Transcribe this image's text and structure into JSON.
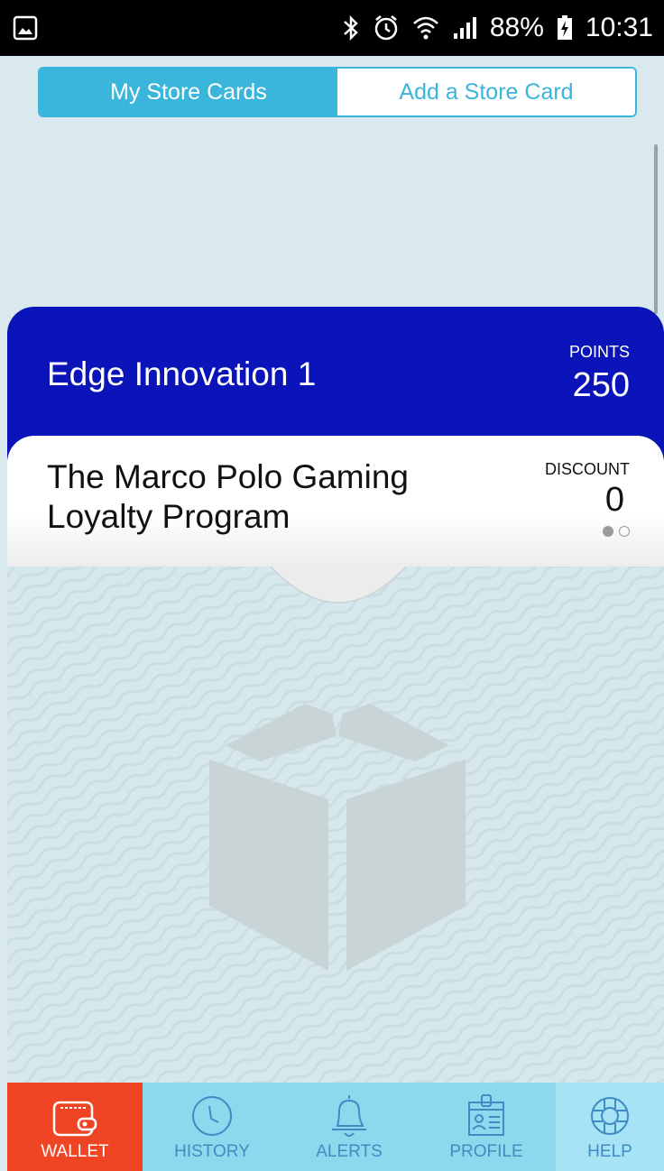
{
  "status_bar": {
    "battery": "88%",
    "time": "10:31"
  },
  "tabs": [
    {
      "label": "My Store Cards",
      "active": true
    },
    {
      "label": "Add a Store Card",
      "active": false
    }
  ],
  "cards": [
    {
      "name": "Edge Innovation 1",
      "metric_label": "POINTS",
      "metric_value": "250",
      "color": "#0a14b8"
    },
    {
      "name": "The Marco Polo Gaming Loyalty Program",
      "metric_label": "DISCOUNT",
      "metric_value": "0",
      "color": "#ffffff"
    }
  ],
  "pager": {
    "current": 1,
    "total": 2
  },
  "bottom_nav": [
    {
      "label": "WALLET",
      "icon": "wallet-icon",
      "active": true
    },
    {
      "label": "HISTORY",
      "icon": "clock-icon",
      "active": false
    },
    {
      "label": "ALERTS",
      "icon": "bell-icon",
      "active": false
    },
    {
      "label": "PROFILE",
      "icon": "id-badge-icon",
      "active": false
    },
    {
      "label": "HELP",
      "icon": "lifebuoy-icon",
      "active": false
    }
  ],
  "colors": {
    "accent": "#3ab5dc",
    "wallet_active": "#f04524",
    "nav_bg": "#8ed8ee",
    "nav_text": "#3f8bc2"
  }
}
